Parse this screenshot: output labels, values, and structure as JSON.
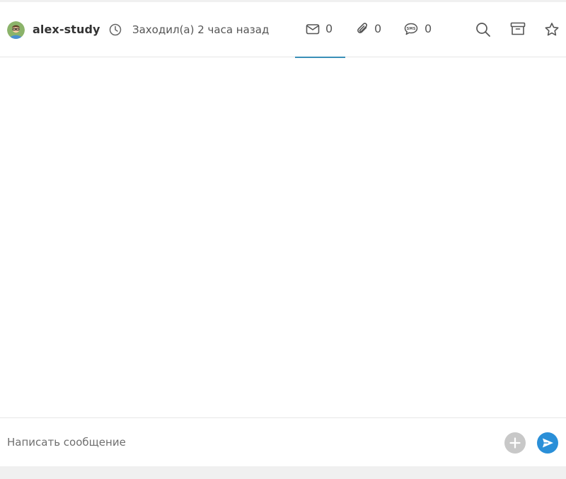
{
  "header": {
    "username": "alex-study",
    "last_seen": "Заходил(а) 2 часа назад",
    "avatar_icon": "avatar-glasses-person",
    "tabs": [
      {
        "icon": "envelope-icon",
        "count": "0",
        "active": true
      },
      {
        "icon": "paperclip-icon",
        "count": "0",
        "active": false
      },
      {
        "icon": "sms-bubble-icon",
        "count": "0",
        "active": false
      }
    ],
    "actions": [
      "search-icon",
      "archive-icon",
      "star-icon"
    ],
    "accent_color": "#3a8fb7"
  },
  "composer": {
    "placeholder": "Написать сообщение",
    "value": "",
    "attach_icon": "plus-icon",
    "send_icon": "send-icon",
    "send_color": "#2a8fd8"
  },
  "sms_icon_text": "SMS"
}
